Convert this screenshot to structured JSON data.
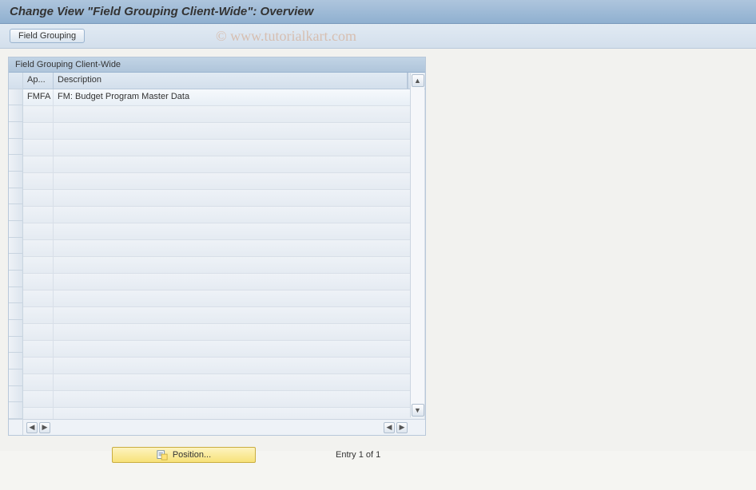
{
  "title": "Change View \"Field Grouping Client-Wide\": Overview",
  "toolbar": {
    "field_grouping_label": "Field Grouping"
  },
  "panel": {
    "header": "Field Grouping Client-Wide",
    "columns": {
      "app": "Ap...",
      "description": "Description"
    },
    "rows": [
      {
        "app": "FMFA",
        "description": "FM: Budget Program Master Data"
      }
    ],
    "empty_row_count": 19
  },
  "footer": {
    "position_label": "Position...",
    "entry_text": "Entry 1 of 1"
  },
  "watermark": "© www.tutorialkart.com"
}
